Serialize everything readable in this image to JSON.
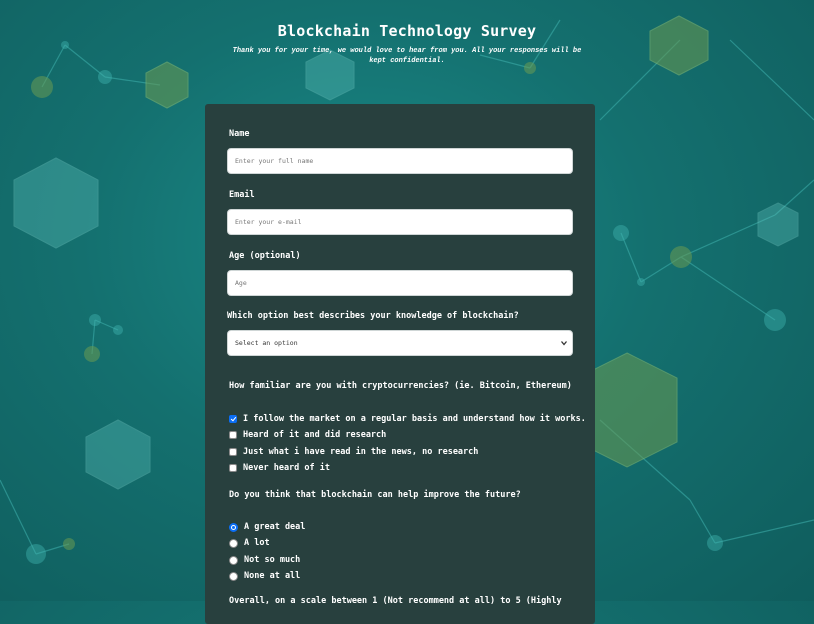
{
  "header": {
    "title": "Blockchain Technology Survey",
    "subtitle": "Thank you for your time, we would love to hear from you. All your responses will be kept confidential."
  },
  "form": {
    "name": {
      "label": "Name",
      "placeholder": "Enter your full name"
    },
    "email": {
      "label": "Email",
      "placeholder": "Enter your e-mail"
    },
    "age": {
      "label": "Age (optional)",
      "placeholder": "Age"
    },
    "knowledge": {
      "question": "Which option best describes your knowledge of blockchain?",
      "selected": "Select an option"
    },
    "familiarity": {
      "question": "How familiar are you with cryptocurrencies? (ie. Bitcoin, Ethereum)",
      "options": [
        {
          "label": "I follow the market on a regular basis and understand how it works.",
          "checked": true
        },
        {
          "label": "Heard of it and did research",
          "checked": false
        },
        {
          "label": "Just what i have read in the news, no research",
          "checked": false
        },
        {
          "label": "Never heard of it",
          "checked": false
        }
      ]
    },
    "future": {
      "question": "Do you think that blockchain can help improve the future?",
      "options": [
        {
          "label": "A great deal",
          "selected": true
        },
        {
          "label": "A lot",
          "selected": false
        },
        {
          "label": "Not so much",
          "selected": false
        },
        {
          "label": "None at all",
          "selected": false
        }
      ]
    },
    "recommend": {
      "question_partial": "Overall, on a scale between 1 (Not recommend at all) to 5 (Highly"
    }
  },
  "colors": {
    "background": "#14706f",
    "card": "#28403e",
    "accent": "#0b6ef5",
    "node_green": "#6a9a52"
  }
}
